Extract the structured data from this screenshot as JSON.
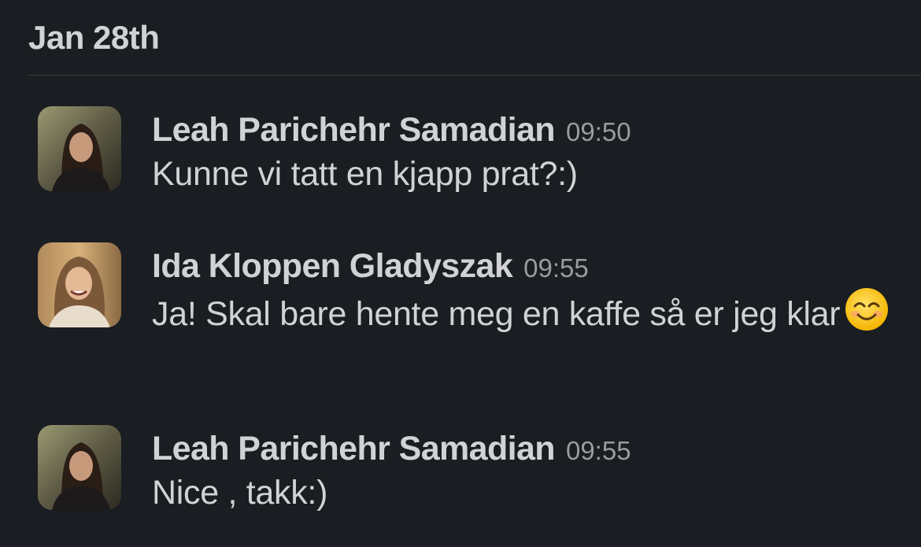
{
  "date_header": "Jan 28th",
  "messages": [
    {
      "sender": "Leah Parichehr Samadian",
      "time": "09:50",
      "text": "Kunne vi tatt en kjapp prat?:)",
      "avatar_icon": "avatar-photo-icon"
    },
    {
      "sender": "Ida Kloppen Gladyszak",
      "time": "09:55",
      "text": "Ja! Skal bare hente meg en kaffe så er jeg klar",
      "emoji": "smiling-face-icon",
      "avatar_icon": "avatar-photo-icon"
    },
    {
      "sender": "Leah Parichehr Samadian",
      "time": "09:55",
      "text": "Nice , takk:)",
      "avatar_icon": "avatar-photo-icon"
    }
  ],
  "colors": {
    "background": "#1a1d21",
    "text": "#d1d2d3",
    "timestamp": "#9a9b9e",
    "divider": "#3a3c40"
  }
}
